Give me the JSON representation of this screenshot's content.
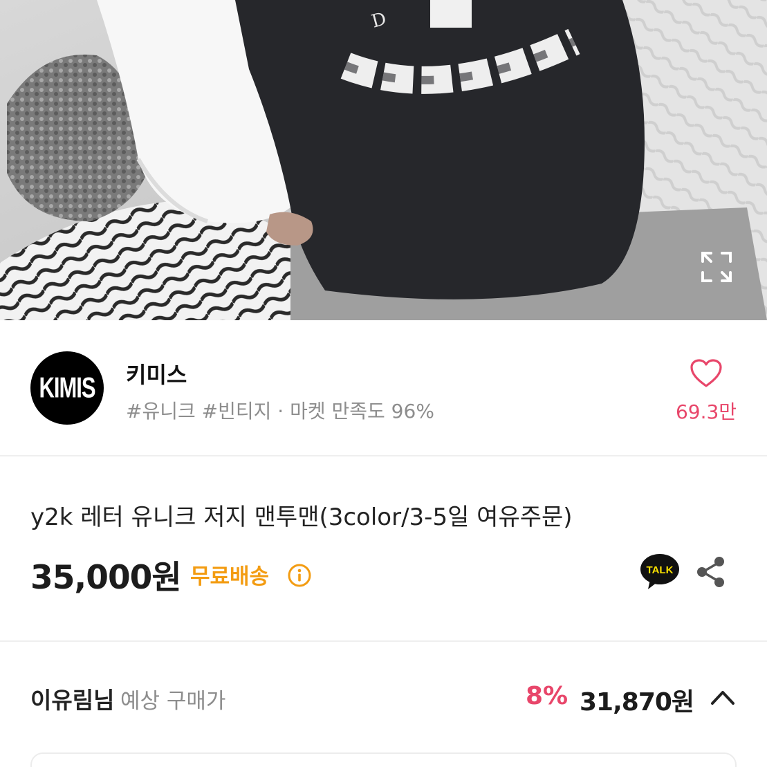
{
  "seller": {
    "avatar_text": "KIMIS",
    "name": "키미스",
    "tags": "#유니크 #빈티지 · 마켓 만족도 96%",
    "like_count": "69.3만"
  },
  "product": {
    "title": "y2k 레터 유니크 저지 맨투맨(3color/3-5일 여유주문)",
    "price": "35,000원",
    "free_shipping": "무료배송",
    "talk_label": "TALK"
  },
  "estimate": {
    "user": "이유림님",
    "label": "예상 구매가",
    "rate": "8%",
    "price": "31,870원"
  },
  "colors": {
    "accent_pink": "#e8466a",
    "shipping_orange": "#f39c12",
    "kakao_yellow": "#f9e000"
  },
  "icons": [
    "expand-icon",
    "heart-icon",
    "info-icon",
    "kakao-talk-icon",
    "share-icon",
    "chevron-up-icon"
  ]
}
